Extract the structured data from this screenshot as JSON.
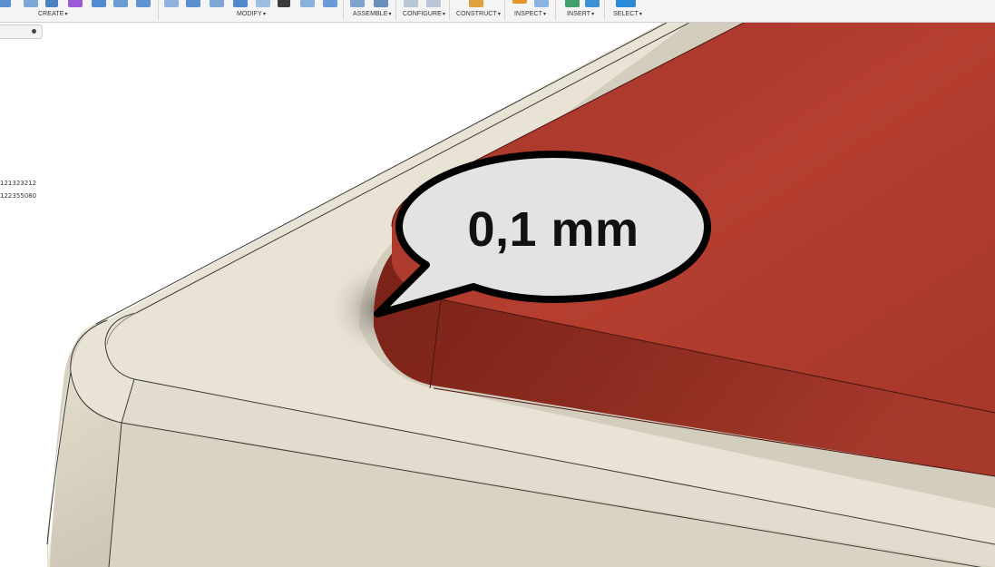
{
  "toolbar": {
    "groups": {
      "create": "CREATE",
      "modify": "MODIFY",
      "assemble": "ASSEMBLE",
      "configure": "CONFIGURE",
      "construct": "CONSTRUCT",
      "inspect": "INSPECT",
      "insert": "INSERT",
      "select": "SELECT"
    },
    "dropdown_caret": "▾"
  },
  "browser": {
    "ids": [
      "121323212",
      "122355080"
    ]
  },
  "callout": {
    "text": "0,1 mm"
  },
  "colors": {
    "plate_red": "#b33a2c",
    "body_beige": "#e6e1d3",
    "toolbar_bg": "#f4f4f4",
    "accent_blue": "#2a8ad6"
  }
}
